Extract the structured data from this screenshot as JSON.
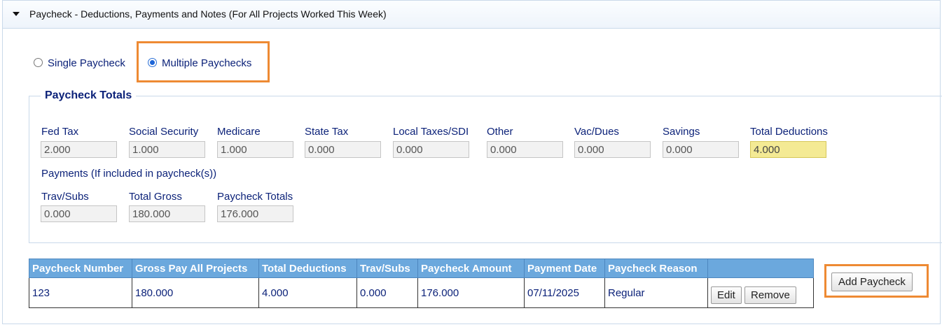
{
  "section": {
    "title": "Paycheck - Deductions, Payments and Notes (For All Projects Worked This Week)"
  },
  "paycheck_mode": {
    "options": [
      {
        "label": "Single Paycheck",
        "checked": false
      },
      {
        "label": "Multiple Paychecks",
        "checked": true
      }
    ]
  },
  "totals": {
    "legend": "Paycheck Totals",
    "deductions": [
      {
        "label": "Fed Tax",
        "value": "2.000"
      },
      {
        "label": "Social Security",
        "value": "1.000"
      },
      {
        "label": "Medicare",
        "value": "1.000"
      },
      {
        "label": "State Tax",
        "value": "0.000"
      },
      {
        "label": "Local Taxes/SDI",
        "value": "0.000"
      },
      {
        "label": "Other",
        "value": "0.000"
      },
      {
        "label": "Vac/Dues",
        "value": "0.000"
      },
      {
        "label": "Savings",
        "value": "0.000"
      },
      {
        "label": "Total Deductions",
        "value": "4.000"
      }
    ],
    "payments_heading": "Payments (If included in paycheck(s))",
    "payments": [
      {
        "label": "Trav/Subs",
        "value": "0.000"
      },
      {
        "label": "Total Gross",
        "value": "180.000"
      },
      {
        "label": "Paycheck Totals",
        "value": "176.000"
      }
    ]
  },
  "paychecks_table": {
    "columns": [
      "Paycheck Number",
      "Gross Pay All Projects",
      "Total Deductions",
      "Trav/Subs",
      "Paycheck Amount",
      "Payment Date",
      "Paycheck Reason",
      ""
    ],
    "rows": [
      {
        "number": "123",
        "gross": "180.000",
        "deductions": "4.000",
        "trav": "0.000",
        "amount": "176.000",
        "date": "07/11/2025",
        "reason": "Regular"
      }
    ],
    "edit_label": "Edit",
    "remove_label": "Remove"
  },
  "add_paycheck_label": "Add Paycheck",
  "colors": {
    "accent_highlight": "#ee8a33",
    "header_blue": "#6ba8dd",
    "text_navy": "#0c2279",
    "total_field": "#f4ea94"
  }
}
